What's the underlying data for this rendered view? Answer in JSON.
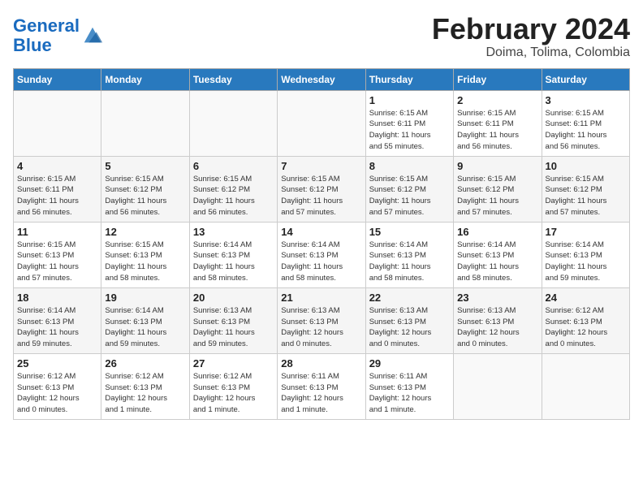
{
  "header": {
    "logo_general": "General",
    "logo_blue": "Blue",
    "month_title": "February 2024",
    "location": "Doima, Tolima, Colombia"
  },
  "columns": [
    "Sunday",
    "Monday",
    "Tuesday",
    "Wednesday",
    "Thursday",
    "Friday",
    "Saturday"
  ],
  "weeks": [
    [
      {
        "day": "",
        "info": ""
      },
      {
        "day": "",
        "info": ""
      },
      {
        "day": "",
        "info": ""
      },
      {
        "day": "",
        "info": ""
      },
      {
        "day": "1",
        "info": "Sunrise: 6:15 AM\nSunset: 6:11 PM\nDaylight: 11 hours\nand 55 minutes."
      },
      {
        "day": "2",
        "info": "Sunrise: 6:15 AM\nSunset: 6:11 PM\nDaylight: 11 hours\nand 56 minutes."
      },
      {
        "day": "3",
        "info": "Sunrise: 6:15 AM\nSunset: 6:11 PM\nDaylight: 11 hours\nand 56 minutes."
      }
    ],
    [
      {
        "day": "4",
        "info": "Sunrise: 6:15 AM\nSunset: 6:11 PM\nDaylight: 11 hours\nand 56 minutes."
      },
      {
        "day": "5",
        "info": "Sunrise: 6:15 AM\nSunset: 6:12 PM\nDaylight: 11 hours\nand 56 minutes."
      },
      {
        "day": "6",
        "info": "Sunrise: 6:15 AM\nSunset: 6:12 PM\nDaylight: 11 hours\nand 56 minutes."
      },
      {
        "day": "7",
        "info": "Sunrise: 6:15 AM\nSunset: 6:12 PM\nDaylight: 11 hours\nand 57 minutes."
      },
      {
        "day": "8",
        "info": "Sunrise: 6:15 AM\nSunset: 6:12 PM\nDaylight: 11 hours\nand 57 minutes."
      },
      {
        "day": "9",
        "info": "Sunrise: 6:15 AM\nSunset: 6:12 PM\nDaylight: 11 hours\nand 57 minutes."
      },
      {
        "day": "10",
        "info": "Sunrise: 6:15 AM\nSunset: 6:12 PM\nDaylight: 11 hours\nand 57 minutes."
      }
    ],
    [
      {
        "day": "11",
        "info": "Sunrise: 6:15 AM\nSunset: 6:13 PM\nDaylight: 11 hours\nand 57 minutes."
      },
      {
        "day": "12",
        "info": "Sunrise: 6:15 AM\nSunset: 6:13 PM\nDaylight: 11 hours\nand 58 minutes."
      },
      {
        "day": "13",
        "info": "Sunrise: 6:14 AM\nSunset: 6:13 PM\nDaylight: 11 hours\nand 58 minutes."
      },
      {
        "day": "14",
        "info": "Sunrise: 6:14 AM\nSunset: 6:13 PM\nDaylight: 11 hours\nand 58 minutes."
      },
      {
        "day": "15",
        "info": "Sunrise: 6:14 AM\nSunset: 6:13 PM\nDaylight: 11 hours\nand 58 minutes."
      },
      {
        "day": "16",
        "info": "Sunrise: 6:14 AM\nSunset: 6:13 PM\nDaylight: 11 hours\nand 58 minutes."
      },
      {
        "day": "17",
        "info": "Sunrise: 6:14 AM\nSunset: 6:13 PM\nDaylight: 11 hours\nand 59 minutes."
      }
    ],
    [
      {
        "day": "18",
        "info": "Sunrise: 6:14 AM\nSunset: 6:13 PM\nDaylight: 11 hours\nand 59 minutes."
      },
      {
        "day": "19",
        "info": "Sunrise: 6:14 AM\nSunset: 6:13 PM\nDaylight: 11 hours\nand 59 minutes."
      },
      {
        "day": "20",
        "info": "Sunrise: 6:13 AM\nSunset: 6:13 PM\nDaylight: 11 hours\nand 59 minutes."
      },
      {
        "day": "21",
        "info": "Sunrise: 6:13 AM\nSunset: 6:13 PM\nDaylight: 12 hours\nand 0 minutes."
      },
      {
        "day": "22",
        "info": "Sunrise: 6:13 AM\nSunset: 6:13 PM\nDaylight: 12 hours\nand 0 minutes."
      },
      {
        "day": "23",
        "info": "Sunrise: 6:13 AM\nSunset: 6:13 PM\nDaylight: 12 hours\nand 0 minutes."
      },
      {
        "day": "24",
        "info": "Sunrise: 6:12 AM\nSunset: 6:13 PM\nDaylight: 12 hours\nand 0 minutes."
      }
    ],
    [
      {
        "day": "25",
        "info": "Sunrise: 6:12 AM\nSunset: 6:13 PM\nDaylight: 12 hours\nand 0 minutes."
      },
      {
        "day": "26",
        "info": "Sunrise: 6:12 AM\nSunset: 6:13 PM\nDaylight: 12 hours\nand 1 minute."
      },
      {
        "day": "27",
        "info": "Sunrise: 6:12 AM\nSunset: 6:13 PM\nDaylight: 12 hours\nand 1 minute."
      },
      {
        "day": "28",
        "info": "Sunrise: 6:11 AM\nSunset: 6:13 PM\nDaylight: 12 hours\nand 1 minute."
      },
      {
        "day": "29",
        "info": "Sunrise: 6:11 AM\nSunset: 6:13 PM\nDaylight: 12 hours\nand 1 minute."
      },
      {
        "day": "",
        "info": ""
      },
      {
        "day": "",
        "info": ""
      }
    ]
  ]
}
